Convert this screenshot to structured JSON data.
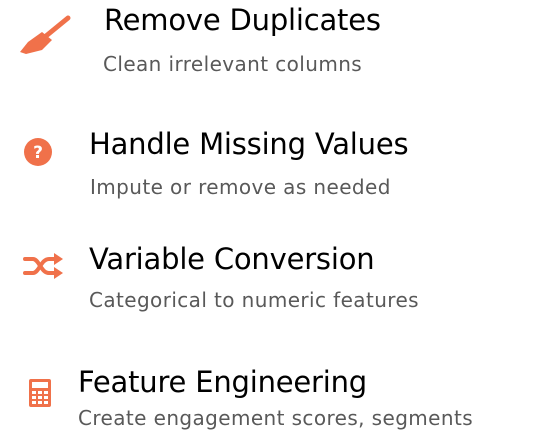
{
  "accent_color": "#f0714a",
  "steps": [
    {
      "icon": "broom-icon",
      "title": "Remove Duplicates",
      "subtitle": "Clean irrelevant columns"
    },
    {
      "icon": "question-circle-icon",
      "title": "Handle Missing Values",
      "subtitle": "Impute or remove as needed"
    },
    {
      "icon": "shuffle-icon",
      "title": "Variable Conversion",
      "subtitle": "Categorical to numeric features"
    },
    {
      "icon": "calculator-icon",
      "title": "Feature Engineering",
      "subtitle": "Create engagement scores, segments"
    }
  ]
}
